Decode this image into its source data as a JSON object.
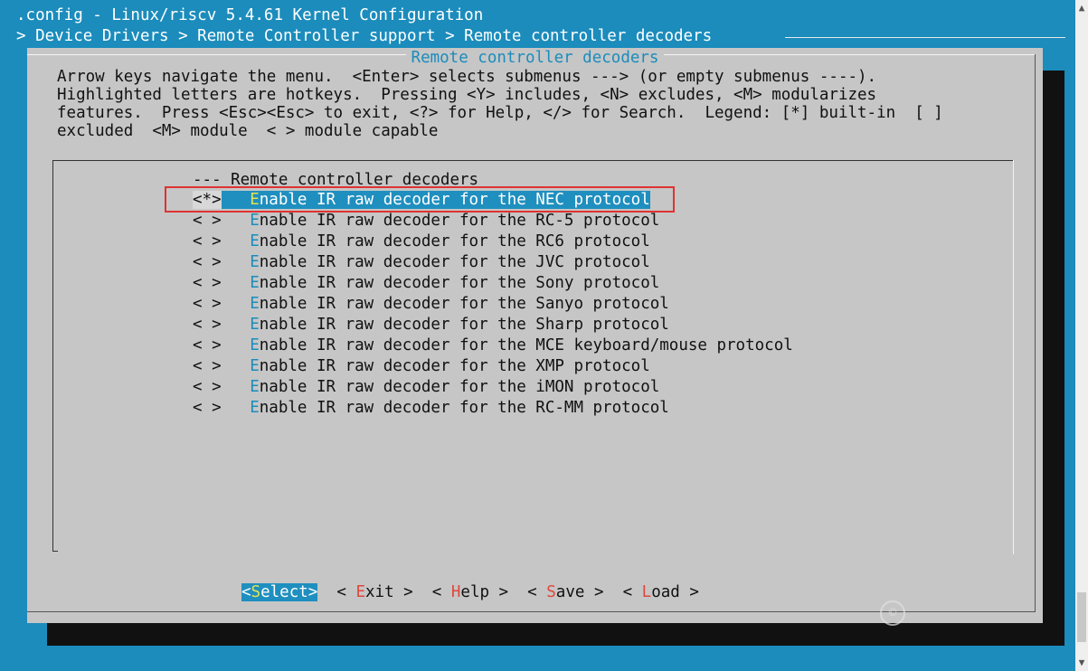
{
  "terminal": {
    "title": ".config - Linux/riscv 5.4.61 Kernel Configuration",
    "path": "> Device Drivers > Remote Controller support > Remote controller decoders"
  },
  "dialog": {
    "title": "Remote controller decoders",
    "help_lines": [
      "Arrow keys navigate the menu.  <Enter> selects submenus ---> (or empty submenus ----).",
      "Highlighted letters are hotkeys.  Pressing <Y> includes, <N> excludes, <M> modularizes",
      "features.  Press <Esc><Esc> to exit, <?> for Help, </> for Search.  Legend: [*] built-in  [ ]",
      "excluded  <M> module  < > module capable"
    ]
  },
  "menu": {
    "header": "--- Remote controller decoders",
    "items": [
      {
        "state": "<*>",
        "hotkey": "E",
        "rest": "nable IR raw decoder for the NEC protocol"
      },
      {
        "state": "< >",
        "hotkey": "E",
        "rest": "nable IR raw decoder for the RC-5 protocol"
      },
      {
        "state": "< >",
        "hotkey": "E",
        "rest": "nable IR raw decoder for the RC6 protocol"
      },
      {
        "state": "< >",
        "hotkey": "E",
        "rest": "nable IR raw decoder for the JVC protocol"
      },
      {
        "state": "< >",
        "hotkey": "E",
        "rest": "nable IR raw decoder for the Sony protocol"
      },
      {
        "state": "< >",
        "hotkey": "E",
        "rest": "nable IR raw decoder for the Sanyo protocol"
      },
      {
        "state": "< >",
        "hotkey": "E",
        "rest": "nable IR raw decoder for the Sharp protocol"
      },
      {
        "state": "< >",
        "hotkey": "E",
        "rest": "nable IR raw decoder for the MCE keyboard/mouse protocol"
      },
      {
        "state": "< >",
        "hotkey": "E",
        "rest": "nable IR raw decoder for the XMP protocol"
      },
      {
        "state": "< >",
        "hotkey": "E",
        "rest": "nable IR raw decoder for the iMON protocol"
      },
      {
        "state": "< >",
        "hotkey": "E",
        "rest": "nable IR raw decoder for the RC-MM protocol"
      }
    ]
  },
  "buttons": {
    "select": {
      "open": "<",
      "hot": "S",
      "rest": "elect>"
    },
    "exit": {
      "open": "< ",
      "hot": "E",
      "rest": "xit >"
    },
    "help": {
      "open": "< ",
      "hot": "H",
      "rest": "elp >"
    },
    "save": {
      "open": "< ",
      "hot": "S",
      "rest": "ave >"
    },
    "load": {
      "open": "< ",
      "hot": "L",
      "rest": "oad >"
    }
  },
  "icons": {
    "scroll_up": "scroll-up-arrow",
    "scroll_down": "scroll-down-arrow",
    "watermark": "watermark-logo"
  },
  "colors": {
    "background": "#1b8cbc",
    "dialog": "#c6c6c6",
    "highlight": "#1f8fbf",
    "hotkey": "#1b8cbc",
    "button_hotkey": "#e0473c",
    "annotation": "#e03232"
  }
}
